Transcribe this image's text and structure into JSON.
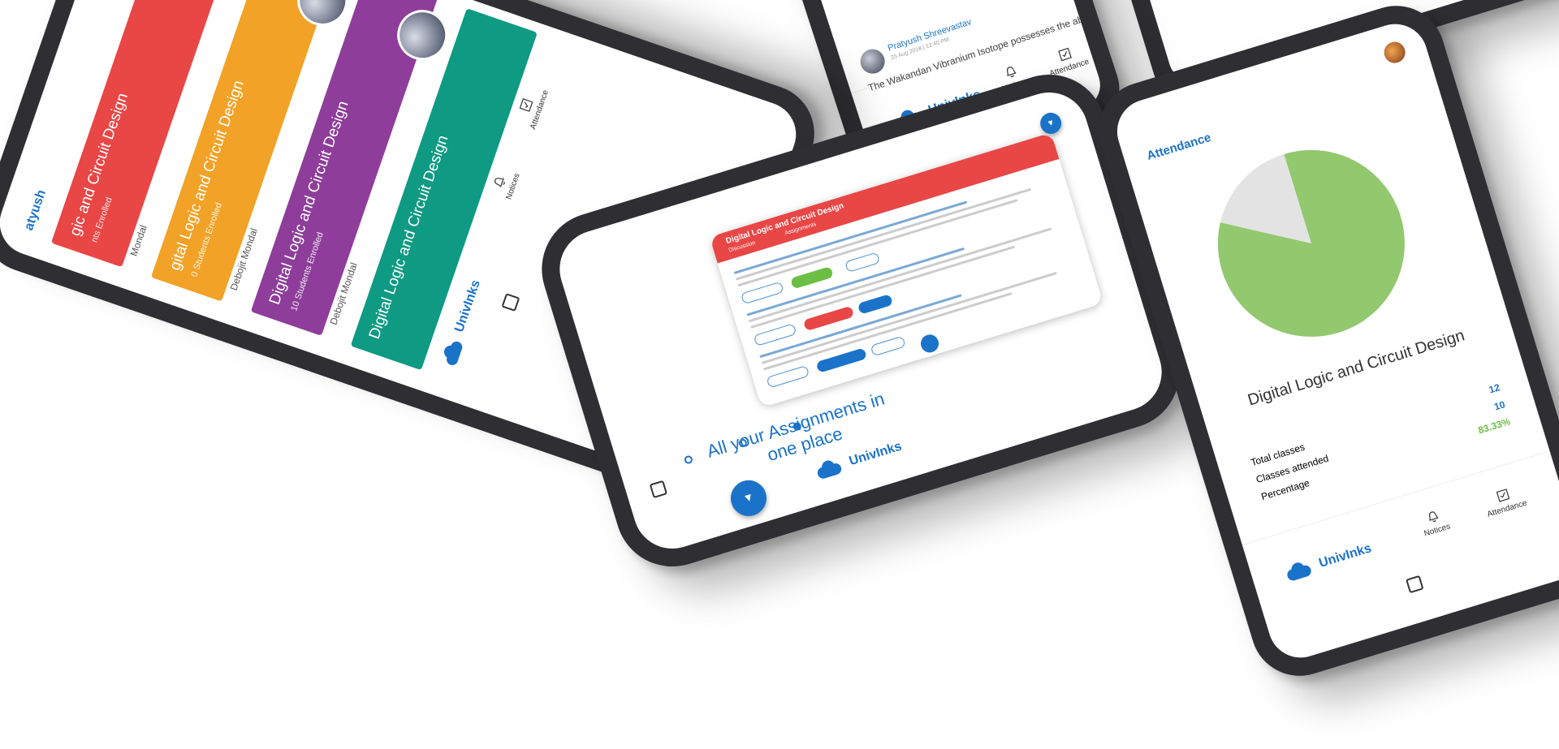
{
  "brand": {
    "name": "UnivInks",
    "color": "#1a73c9"
  },
  "course_list_screen": {
    "header_user": "atyush",
    "courses": [
      {
        "title": "gic and Circuit Design",
        "subtitle": "nts Enrolled",
        "instructor": "Mondal",
        "color": "#e94646"
      },
      {
        "title": "gital Logic and Circuit Design",
        "subtitle": "0 Students Enrolled",
        "instructor": "Debojit Mondal",
        "color": "#f2a227"
      },
      {
        "title": "Digital Logic and Circuit Design",
        "subtitle": "10 Students Enrolled",
        "instructor": "Debojit Mondal",
        "color": "#8e3d9a"
      },
      {
        "title": "Digital Logic and Circuit Design",
        "subtitle": "",
        "instructor": "",
        "color": "#0e9a83"
      }
    ],
    "nav": {
      "notices": "Notices",
      "attendance": "Attendance"
    }
  },
  "notices_screen": {
    "author": "Pratyush Shreevastav",
    "timestamp": "25 Aug 2018 | 12:40 PM",
    "excerpt": "The Wakandan Vibranium Isotope possesses the ability",
    "nav": {
      "notices": "Notices",
      "attendance": "Attendance"
    }
  },
  "onboarding_screen": {
    "headline_line1": "All your Assignments in",
    "headline_line2": "one place",
    "preview_title": "Digital Logic and Circuit Design",
    "preview_tab1": "Discussion",
    "preview_tab2": "Assignments",
    "active_dot_index": 2,
    "dot_count": 3
  },
  "attendance_screen": {
    "title": "Attendance",
    "course": "Digital Logic and Circuit Design",
    "rows": [
      {
        "label": "Total classes",
        "value": "12",
        "value_color": "#1a73c9"
      },
      {
        "label": "Classes attended",
        "value": "10",
        "value_color": "#1a73c9"
      },
      {
        "label": "Percentage",
        "value": "83.33%",
        "value_color": "#6cbf45"
      }
    ],
    "chart_data": {
      "type": "pie",
      "values": [
        10,
        2
      ],
      "colors": [
        "#92c86e",
        "#e3e3e3"
      ]
    },
    "nav": {
      "notices": "Notices",
      "attendance": "Attendance"
    }
  }
}
